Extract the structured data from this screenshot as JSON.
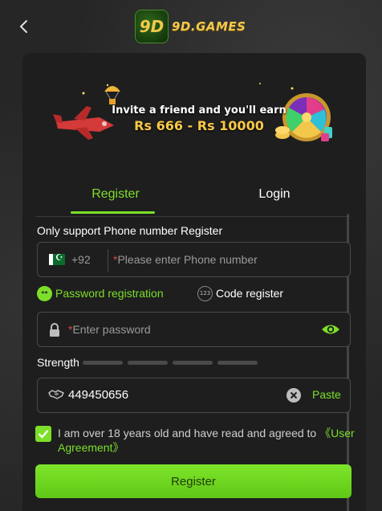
{
  "header": {
    "logo_mark": "9D",
    "logo_text": "9D.GAMES"
  },
  "banner": {
    "line1": "Invite a friend and you'll earn",
    "line2": "Rs 666 - Rs 10000"
  },
  "tabs": [
    {
      "label": "Register",
      "active": true
    },
    {
      "label": "Login",
      "active": false
    }
  ],
  "phone": {
    "section_label": "Only support Phone number Register",
    "country_code": "+92",
    "required_mark": "*",
    "placeholder": "Please enter Phone number"
  },
  "options": {
    "password_registration": "Password registration",
    "password_icon_text": "**",
    "code_register": "Code register",
    "code_icon_text": "123"
  },
  "password": {
    "required_mark": "*",
    "placeholder": "Enter password"
  },
  "strength": {
    "label": "Strength",
    "level": 0
  },
  "captcha": {
    "value": "449450656",
    "paste_label": "Paste"
  },
  "agreement": {
    "checked": true,
    "text": "I am over 18 years old and have read and agreed to ",
    "link": "《User Agreement》"
  },
  "submit": {
    "label": "Register"
  },
  "colors": {
    "accent": "#7ddf2a",
    "card_bg": "#1e1e1e",
    "page_bg": "#262626",
    "required": "#e04848"
  }
}
